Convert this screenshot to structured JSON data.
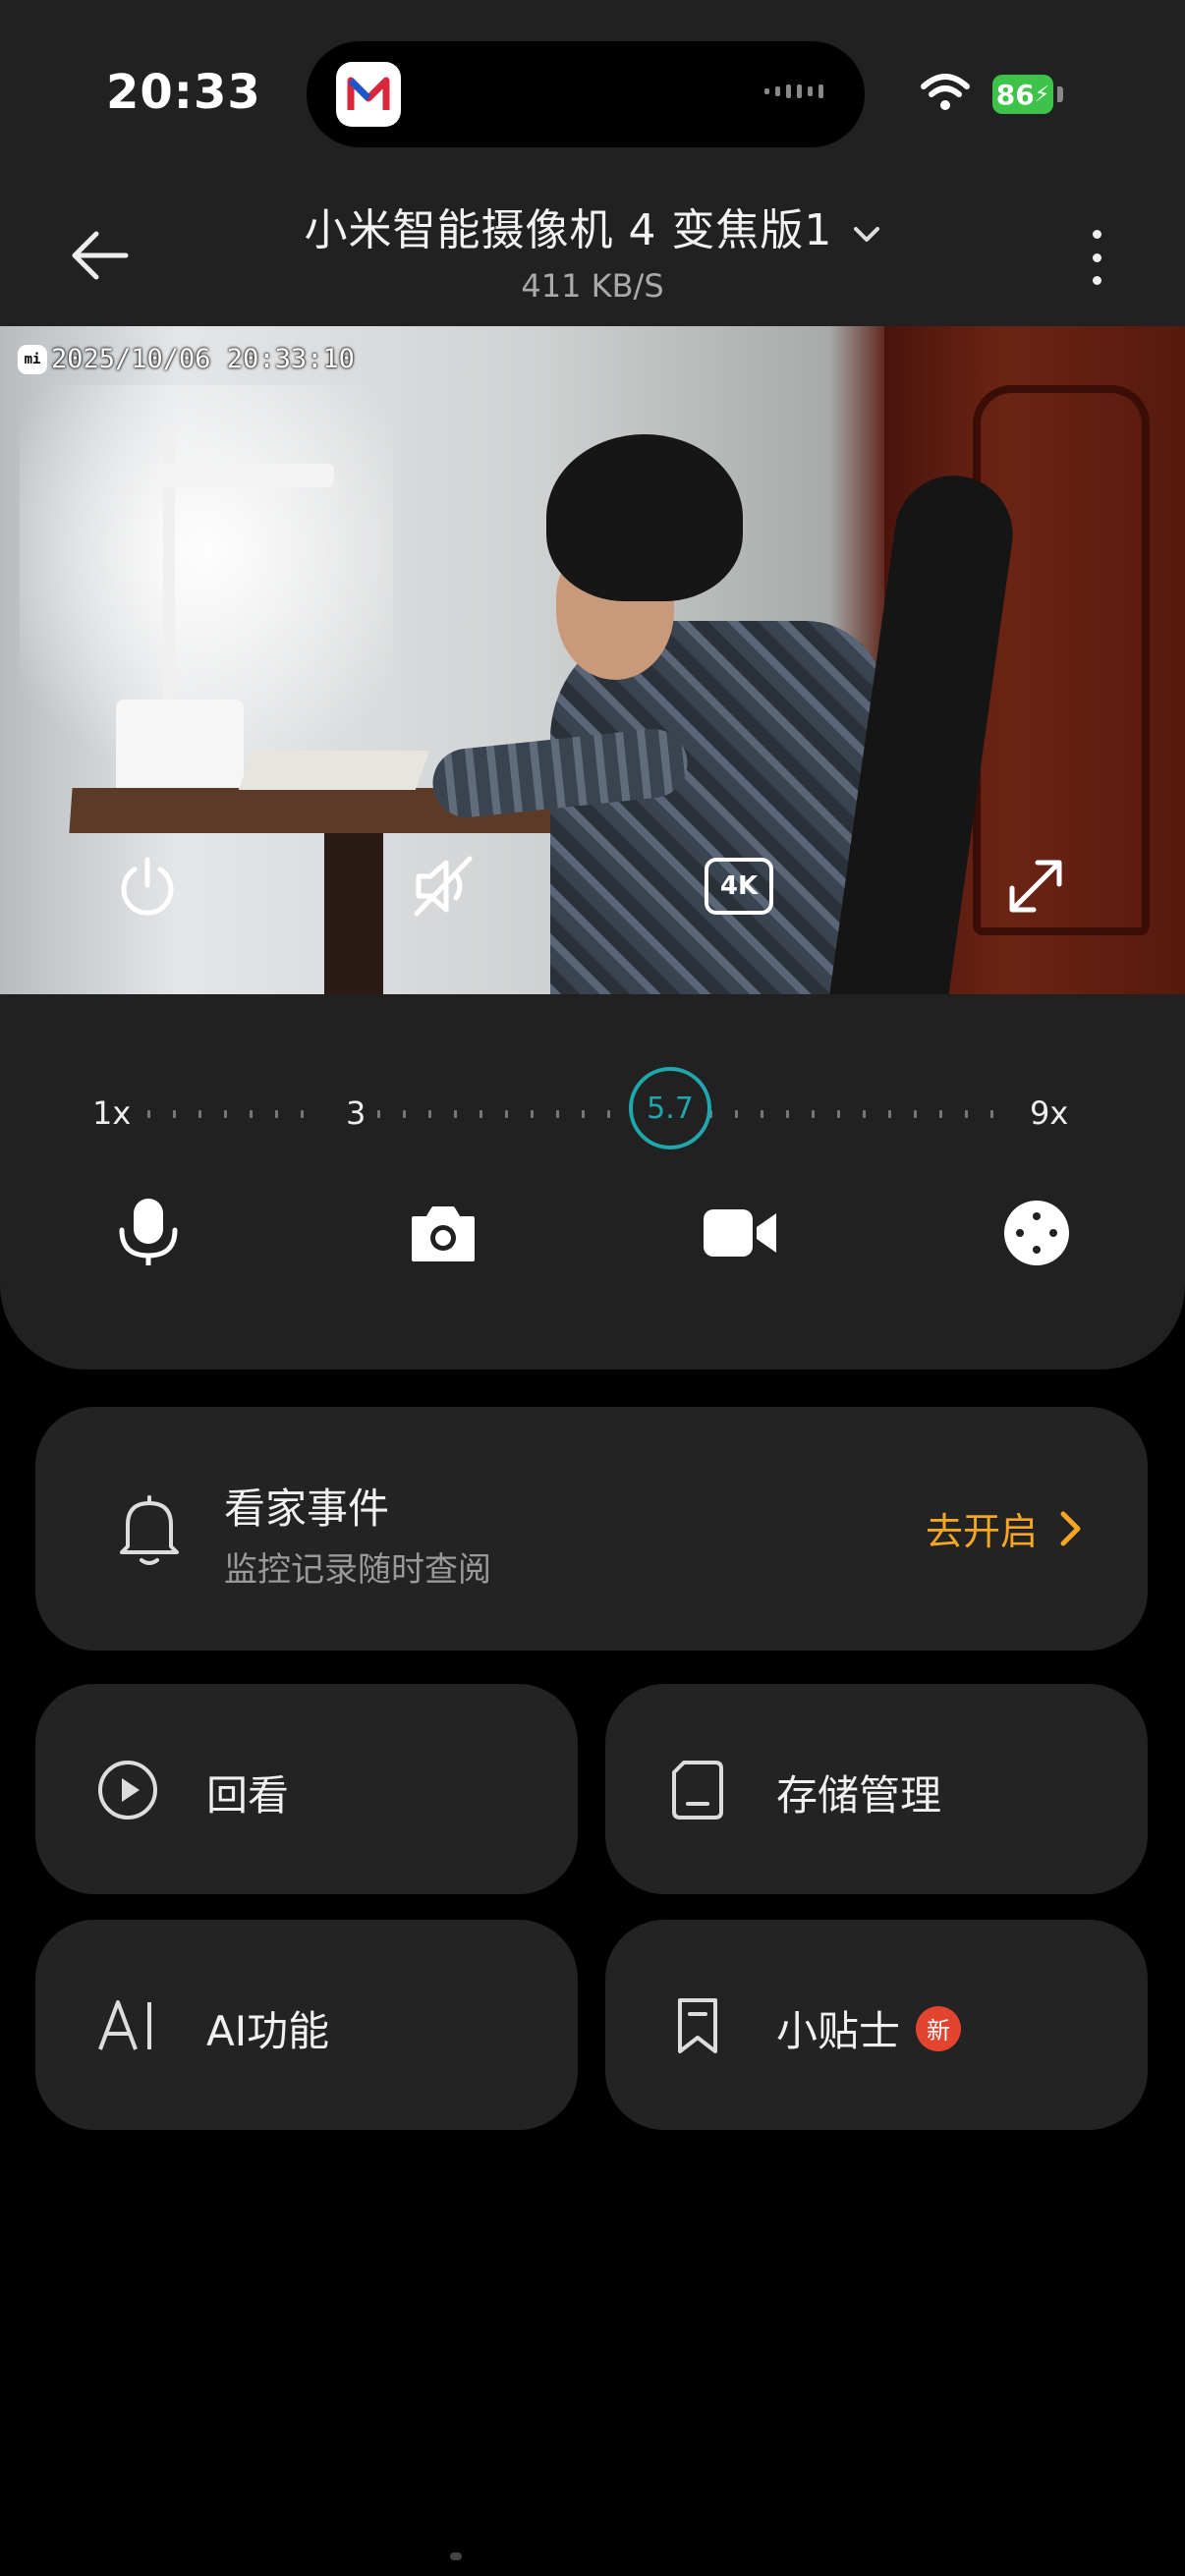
{
  "status_bar": {
    "time": "20:33",
    "battery": "86"
  },
  "header": {
    "title": "小米智能摄像机 4 变焦版1",
    "subtitle": "411 KB/S"
  },
  "video": {
    "timestamp": "2025/10/06 20:33:10",
    "osd_logo": "mi",
    "quality_label": "4K"
  },
  "zoom": {
    "min_label": "1x",
    "mid_label": "3",
    "max_label": "9x",
    "current": "5.7"
  },
  "events_card": {
    "title": "看家事件",
    "subtitle": "监控记录随时查阅",
    "action": "去开启"
  },
  "tiles": [
    {
      "label": "回看",
      "icon": "play-circle-icon"
    },
    {
      "label": "存储管理",
      "icon": "storage-icon"
    },
    {
      "label": "AI功能",
      "icon": "ai-icon"
    },
    {
      "label": "小贴士",
      "icon": "bookmark-icon",
      "badge": "新"
    }
  ],
  "colors": {
    "accent_teal": "#1fa7ad",
    "accent_orange": "#f6a623",
    "badge_red": "#e2442f",
    "battery_green": "#3ec34a"
  }
}
